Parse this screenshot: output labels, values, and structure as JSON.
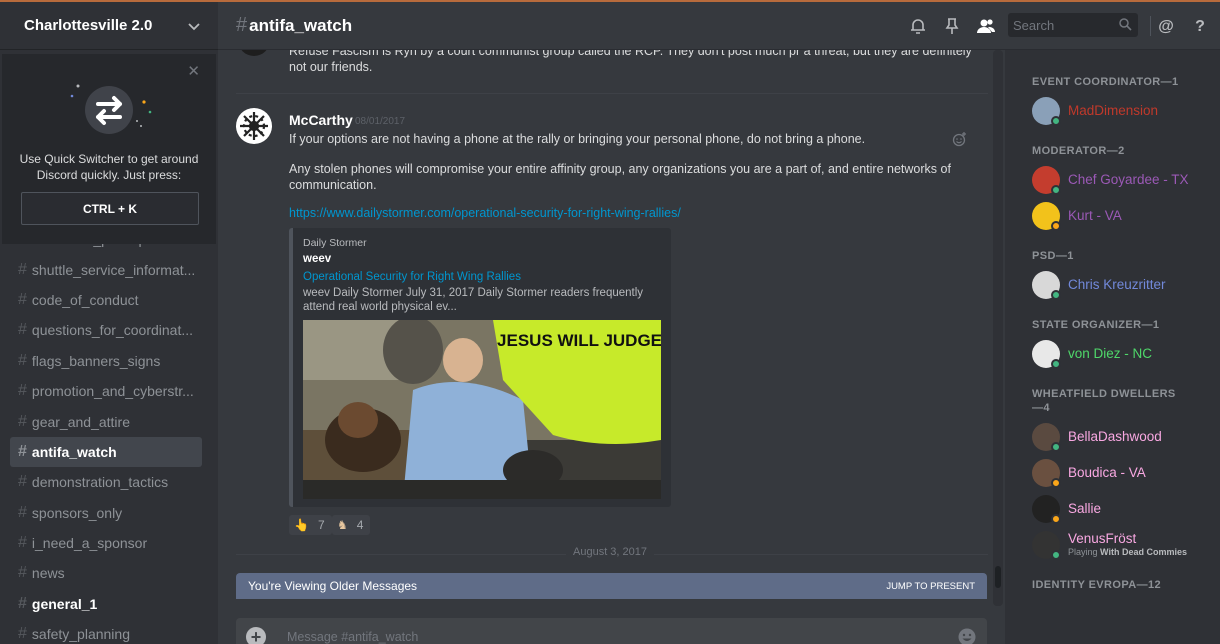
{
  "colors": {
    "online": "#43b581",
    "idle": "#faa61a",
    "link": "#0096cf",
    "older_bar": "#5f6c88"
  },
  "server": {
    "name": "Charlottesville 2.0"
  },
  "quick_switcher": {
    "text": "Use Quick Switcher to get around Discord quickly. Just press:",
    "shortcut": "CTRL + K"
  },
  "channels": [
    {
      "name": "confirmed_participants",
      "state": "normal"
    },
    {
      "name": "shuttle_service_informat...",
      "state": "normal"
    },
    {
      "name": "code_of_conduct",
      "state": "normal"
    },
    {
      "name": "questions_for_coordinat...",
      "state": "normal"
    },
    {
      "name": "flags_banners_signs",
      "state": "normal"
    },
    {
      "name": "promotion_and_cyberstr...",
      "state": "normal"
    },
    {
      "name": "gear_and_attire",
      "state": "normal"
    },
    {
      "name": "antifa_watch",
      "state": "active"
    },
    {
      "name": "demonstration_tactics",
      "state": "normal"
    },
    {
      "name": "sponsors_only",
      "state": "normal"
    },
    {
      "name": "i_need_a_sponsor",
      "state": "normal"
    },
    {
      "name": "news",
      "state": "normal"
    },
    {
      "name": "general_1",
      "state": "unread"
    },
    {
      "name": "safety_planning",
      "state": "normal"
    }
  ],
  "header": {
    "channel": "antifa_watch",
    "search_placeholder": "Search",
    "icons": [
      "bell-icon",
      "pin-icon",
      "members-icon",
      "search-icon",
      "at-icon",
      "help-icon"
    ]
  },
  "messages": {
    "previous_text": "Refuse Fascism is Ryn by a court communist group called the RCP. They don't post much pr a threat, but they are definitely not our friends.",
    "author": "McCarthy",
    "timestamp": "08/01/2017",
    "body1": "If your options are not having a phone at the rally or bringing your personal phone, do not bring a phone.",
    "body2": "Any stolen phones will compromise your entire affinity group, any organizations you are a part of, and entire networks of communication.",
    "link": "https://www.dailystormer.com/operational-security-for-right-wing-rallies/",
    "embed": {
      "provider": "Daily Stormer",
      "author": "weev",
      "title": "Operational Security for Right Wing Rallies",
      "description": "weev Daily Stormer July 31, 2017 Daily Stormer readers frequently attend real world physical ev...",
      "image_caption": "JESUS WILL JUDGE YOU!"
    },
    "reactions": [
      {
        "icon": "pointing-hand-icon",
        "count": "7"
      },
      {
        "icon": "figure-emoji-icon",
        "count": "4"
      }
    ],
    "date_divider": "August 3, 2017",
    "older_notice": "You're Viewing Older Messages",
    "jump_label": "JUMP TO PRESENT"
  },
  "composer": {
    "placeholder": "Message #antifa_watch"
  },
  "member_roles": [
    {
      "title": "EVENT COORDINATOR—1",
      "members": [
        {
          "name": "MadDimension",
          "color": "#c0392b",
          "status": "online"
        }
      ]
    },
    {
      "title": "MODERATOR—2",
      "members": [
        {
          "name": "Chef Goyardee - TX",
          "color": "#9b59b6",
          "status": "online"
        },
        {
          "name": "Kurt - VA",
          "color": "#9b59b6",
          "status": "idle"
        }
      ]
    },
    {
      "title": "PSD—1",
      "members": [
        {
          "name": "Chris Kreuzritter",
          "color": "#7289da",
          "status": "online"
        }
      ]
    },
    {
      "title": "STATE ORGANIZER—1",
      "members": [
        {
          "name": "von Diez - NC",
          "color": "#4fd86a",
          "status": "online"
        }
      ]
    },
    {
      "title": "WHEATFIELD DWELLERS—4",
      "members": [
        {
          "name": "BellaDashwood",
          "color": "#f9a8e2",
          "status": "online"
        },
        {
          "name": "Boudica - VA",
          "color": "#f9a8e2",
          "status": "idle"
        },
        {
          "name": "Sallie",
          "color": "#f9a8e2",
          "status": "idle"
        },
        {
          "name": "VenusFröst",
          "color": "#f9a8e2",
          "status": "online",
          "activity_prefix": "Playing",
          "activity_game": "With Dead Commies"
        }
      ]
    },
    {
      "title": "IDENTITY EVROPA—12",
      "members": []
    }
  ]
}
